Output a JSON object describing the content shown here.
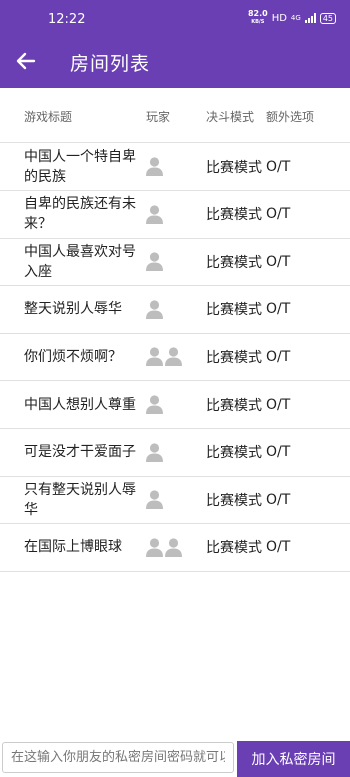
{
  "status": {
    "time": "12:22",
    "speed_value": "82.0",
    "speed_unit": "KB/S",
    "network": "HD",
    "signal": "4G",
    "battery": "45"
  },
  "app_bar": {
    "title": "房间列表",
    "back_icon": "arrow-left-icon"
  },
  "table": {
    "headers": {
      "title": "游戏标题",
      "players": "玩家",
      "mode": "决斗模式",
      "extra": "额外选项"
    },
    "rows": [
      {
        "title": "中国人一个特自卑的民族",
        "players": 1,
        "mode": "比赛模式",
        "extra": "O/T"
      },
      {
        "title": "自卑的民族还有未来？",
        "players": 1,
        "mode": "比赛模式",
        "extra": "O/T"
      },
      {
        "title": "中国人最喜欢对号入座",
        "players": 1,
        "mode": "比赛模式",
        "extra": "O/T"
      },
      {
        "title": "整天说别人辱华",
        "players": 1,
        "mode": "比赛模式",
        "extra": "O/T"
      },
      {
        "title": "你们烦不烦啊？",
        "players": 2,
        "mode": "比赛模式",
        "extra": "O/T"
      },
      {
        "title": "中国人想别人尊重",
        "players": 1,
        "mode": "比赛模式",
        "extra": "O/T"
      },
      {
        "title": "可是没才干爱面子",
        "players": 1,
        "mode": "比赛模式",
        "extra": "O/T"
      },
      {
        "title": "只有整天说别人辱华",
        "players": 1,
        "mode": "比赛模式",
        "extra": "O/T"
      },
      {
        "title": "在国际上博眼球",
        "players": 2,
        "mode": "比赛模式",
        "extra": "O/T"
      }
    ]
  },
  "bottom": {
    "input_placeholder": "在这输入你朋友的私密房间密码就可以",
    "join_label": "加入私密房间"
  },
  "colors": {
    "primary": "#6a3fb4",
    "person_icon": "#bdbdbd"
  }
}
